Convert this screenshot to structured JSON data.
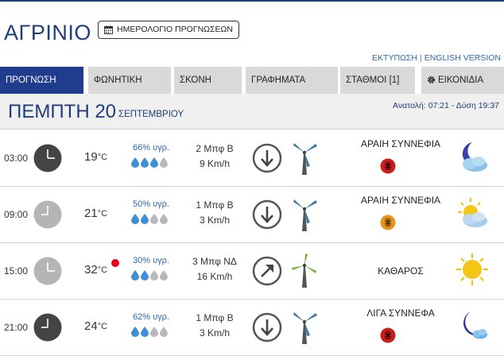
{
  "header": {
    "city": "ΑΓΡΙΝΙΟ",
    "calendar_button": "ΗΜΕΡΟΛΟΓΙΟ ΠΡΟΓΝΩΣΕΩΝ",
    "print_link": "ΕΚΤΥΠΩΣΗ",
    "separator": "|",
    "english_link": "ENGLISH VERSION"
  },
  "tabs": [
    {
      "label": "ΠΡΟΓΝΩΣΗ",
      "active": true
    },
    {
      "label": "ΦΩΝΗΤΙΚΗ",
      "active": false
    },
    {
      "label": "ΣΚΟΝΗ",
      "active": false
    },
    {
      "label": "ΓΡΑΦΗΜΑΤΑ",
      "active": false
    },
    {
      "label": "ΣΤΑΘΜΟΙ [1]",
      "active": false
    },
    {
      "label": "ΕΙΚΟΝΙΔΙΑ",
      "active": false
    }
  ],
  "day": {
    "name": "ΠΕΜΠΤΗ 20",
    "month": "ΣΕΠΤΕΜΒΡΙΟΥ",
    "sun": "Ανατολή: 07:21  - Δύση 19:37"
  },
  "rows": [
    {
      "time": "03:00",
      "temp": "19",
      "unit": "°C",
      "humidity": "66% υγρ.",
      "drops_filled": 3,
      "wind_bf": "2 Μπφ Β",
      "wind_kmh": "9 Km/h",
      "direction": "north",
      "condition": "ΑΡΑΙΗ ΣΥΝΝΕΦΙΑ",
      "badge_color": "#cc1f1a",
      "weather_icon": "moon-cloud-icon",
      "clock": "dark",
      "hot": false
    },
    {
      "time": "09:00",
      "temp": "21",
      "unit": "°C",
      "humidity": "50% υγρ.",
      "drops_filled": 2,
      "wind_bf": "1 Μπφ Β",
      "wind_kmh": "3 Km/h",
      "direction": "north",
      "condition": "ΑΡΑΙΗ ΣΥΝΝΕΦΙΑ",
      "badge_color": "#e8951c",
      "weather_icon": "sun-cloud-icon",
      "clock": "light",
      "hot": false
    },
    {
      "time": "15:00",
      "temp": "32",
      "unit": "°C",
      "humidity": "30% υγρ.",
      "drops_filled": 2,
      "wind_bf": "3 Μπφ ΝΔ",
      "wind_kmh": "16 Km/h",
      "direction": "southwest",
      "condition": "ΚΑΘΑΡΟΣ",
      "badge_color": "",
      "weather_icon": "sun-icon",
      "clock": "light",
      "hot": true
    },
    {
      "time": "21:00",
      "temp": "24",
      "unit": "°C",
      "humidity": "62% υγρ.",
      "drops_filled": 2,
      "wind_bf": "1 Μπφ Β",
      "wind_kmh": "3 Km/h",
      "direction": "north",
      "condition": "ΛΙΓΑ ΣΥΝΝΕΦΑ",
      "badge_color": "#cc1f1a",
      "weather_icon": "moon-cloud-icon",
      "clock": "dark",
      "hot": false
    }
  ],
  "colors": {
    "accent": "#1f3d8c",
    "link": "#2a6ab0",
    "drop_filled": "#3f8fd6",
    "drop_empty": "#b8b8b8",
    "hot_dot": "#e8001c"
  }
}
